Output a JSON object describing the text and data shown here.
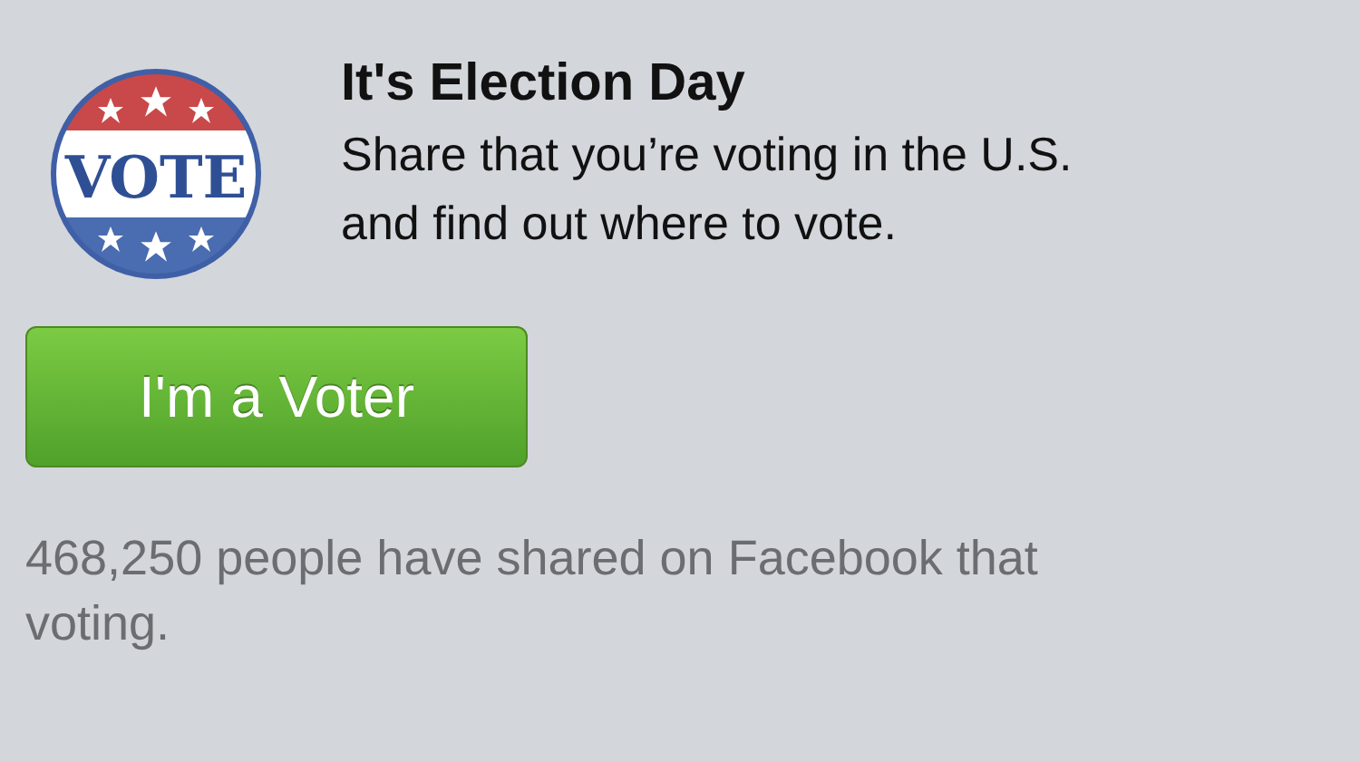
{
  "badge": {
    "label": "VOTE"
  },
  "title": "It's Election Day",
  "description": "Share that you’re voting in the U.S.\nand find out where to vote.",
  "button": {
    "label": "I'm a Voter"
  },
  "footer": "468,250 people have shared on Facebook that\nvoting."
}
